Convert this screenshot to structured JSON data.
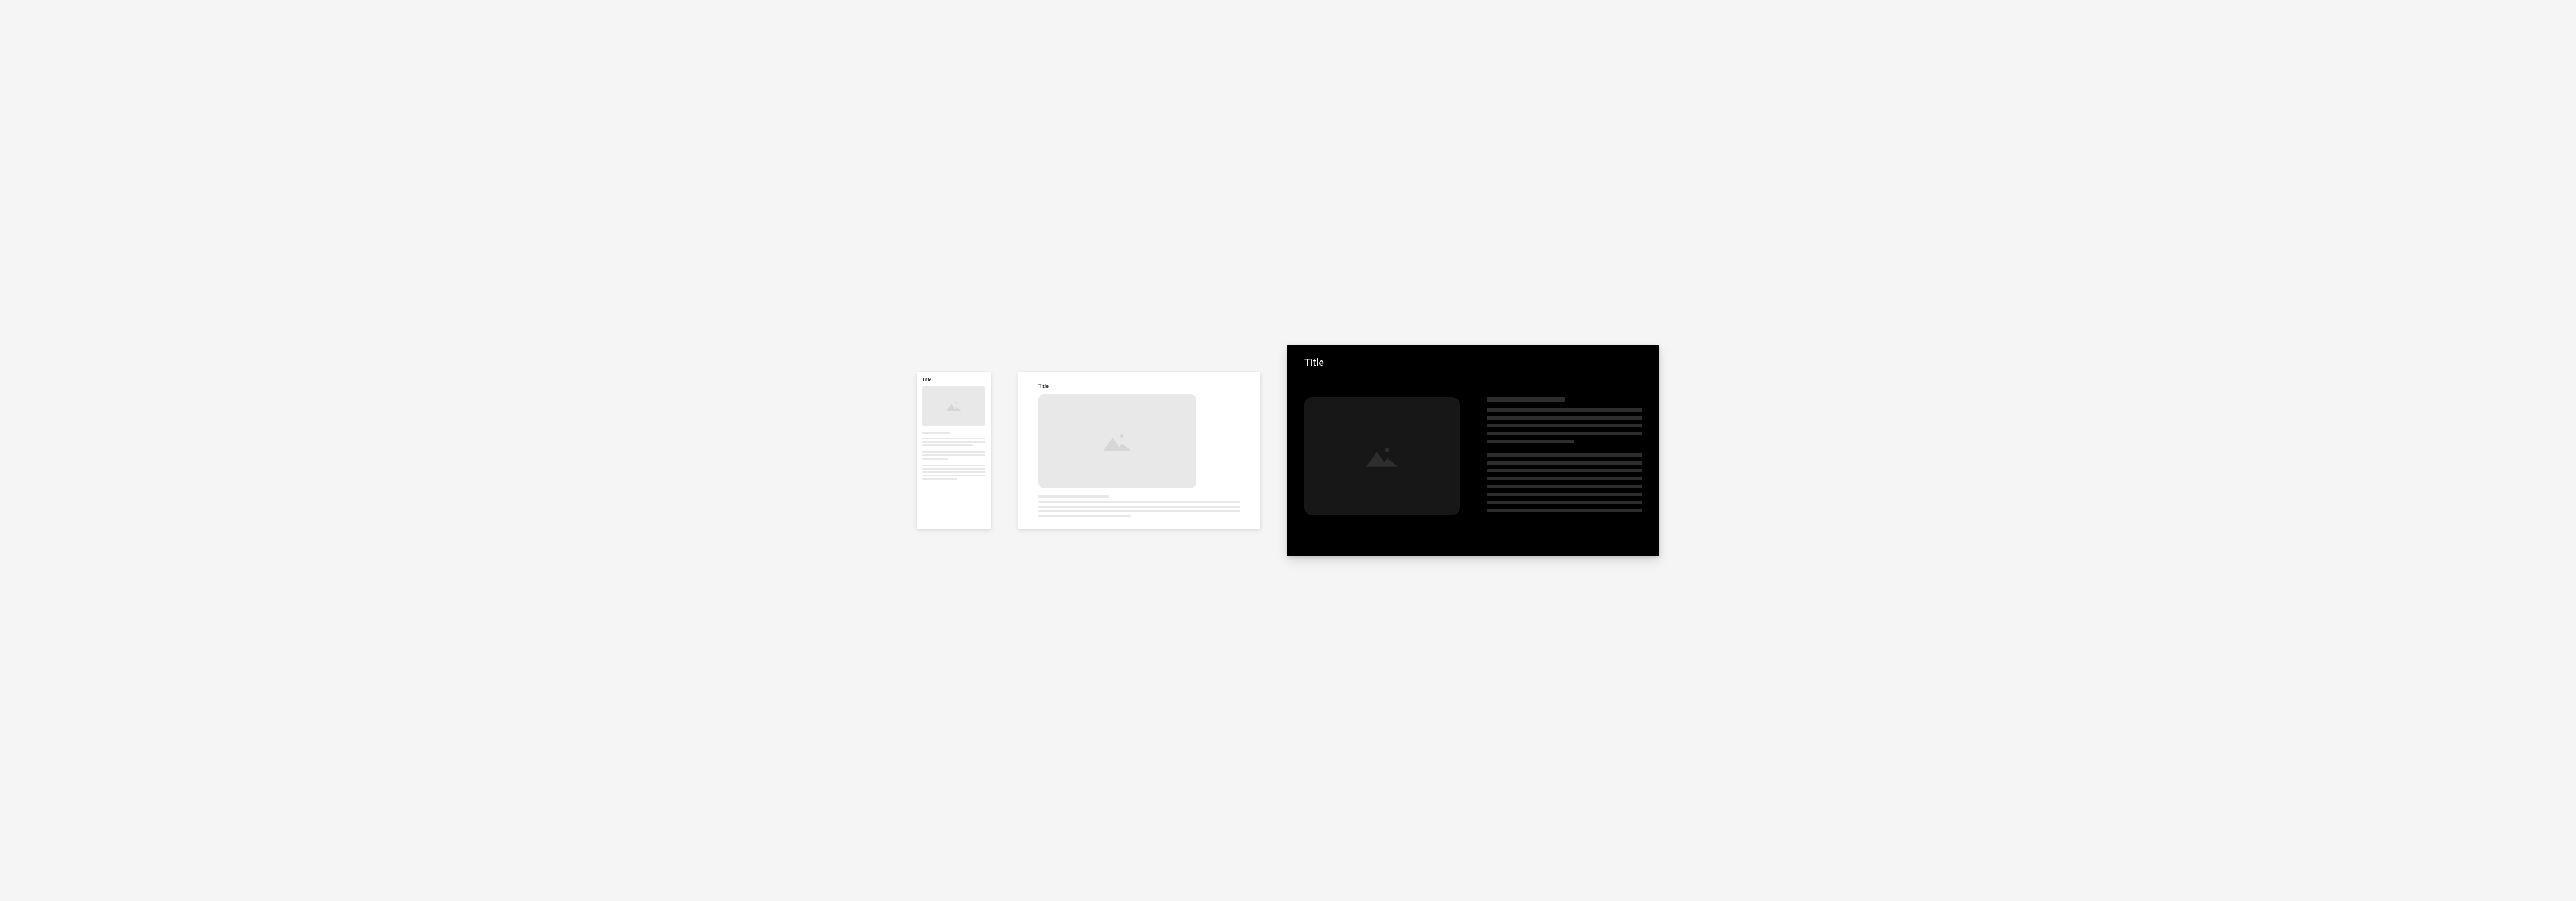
{
  "frames": {
    "phone": {
      "title": "Title"
    },
    "tablet": {
      "title": "Title"
    },
    "tv": {
      "title": "Title"
    }
  },
  "icon": "mountains-icon",
  "colors": {
    "page_bg": "#f5f5f5",
    "light_card_bg": "#ffffff",
    "light_placeholder": "#e8e8e8",
    "light_icon": "#d6d6d6",
    "dark_card_bg": "#000000",
    "dark_placeholder": "#171717",
    "dark_bar": "#2e2e2e",
    "dark_icon": "#2e2e2e",
    "title_light": "#1a1a1a",
    "title_dark": "#ffffff"
  }
}
